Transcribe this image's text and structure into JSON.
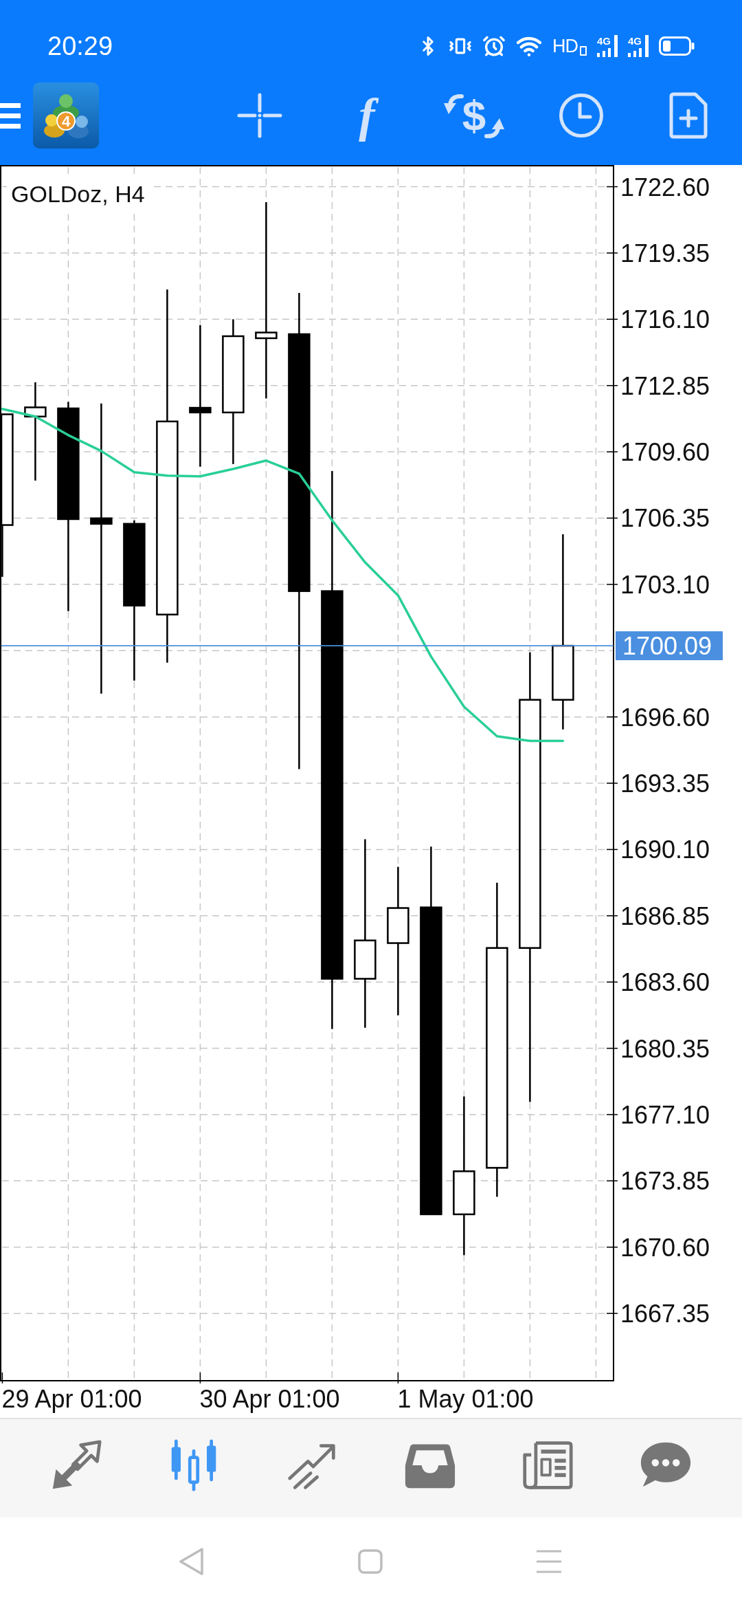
{
  "status_bar": {
    "time": "20:29",
    "hd": "HD",
    "networks": [
      "4G",
      "4G"
    ]
  },
  "toolbar": {
    "logo_badge": "4",
    "actions": [
      {
        "kind": "crosshair"
      },
      {
        "kind": "indicators",
        "glyph": "f"
      },
      {
        "kind": "trade",
        "glyph": "$"
      },
      {
        "kind": "timeframe"
      },
      {
        "kind": "templates"
      }
    ]
  },
  "chart": {
    "title": "GOLDoz, H4",
    "time_labels": [
      "29 Apr 01:00",
      "30 Apr 01:00",
      "1 May 01:00"
    ],
    "chart_data": {
      "type": "line",
      "ylim": [
        1664.05,
        1723.63
      ],
      "yticks": [
        {
          "value": 1722.6,
          "label": "1722.60"
        },
        {
          "value": 1719.35,
          "label": "1719.35"
        },
        {
          "value": 1716.1,
          "label": "1716.10"
        },
        {
          "value": 1712.85,
          "label": "1712.85"
        },
        {
          "value": 1709.6,
          "label": "1709.60"
        },
        {
          "value": 1706.35,
          "label": "1706.35"
        },
        {
          "value": 1703.1,
          "label": "1703.10"
        },
        {
          "value": 1696.6,
          "label": "1696.60"
        },
        {
          "value": 1693.35,
          "label": "1693.35"
        },
        {
          "value": 1690.1,
          "label": "1690.10"
        },
        {
          "value": 1686.85,
          "label": "1686.85"
        },
        {
          "value": 1683.6,
          "label": "1683.60"
        },
        {
          "value": 1680.35,
          "label": "1680.35"
        },
        {
          "value": 1677.1,
          "label": "1677.10"
        },
        {
          "value": 1673.85,
          "label": "1673.85"
        },
        {
          "value": 1670.6,
          "label": "1670.60"
        },
        {
          "value": 1667.35,
          "label": "1667.35"
        }
      ],
      "grid": true,
      "series": [
        {
          "color": "#29cf96",
          "values": [
            1711.7,
            1711.33,
            1710.42,
            1709.64,
            1708.6,
            1708.43,
            1708.4,
            1708.76,
            1709.17,
            1708.53,
            1706.24,
            1704.18,
            1702.56,
            1699.56,
            1697.1,
            1695.65,
            1695.42,
            1695.42
          ]
        }
      ],
      "ref_lines": [
        {
          "axis": "y",
          "value": 1700.09,
          "label": "1700.09",
          "color": "#4a8fe0"
        }
      ]
    }
  },
  "bottom_nav": [
    {
      "kind": "quotes",
      "selected": false
    },
    {
      "kind": "chart",
      "selected": true
    },
    {
      "kind": "trade",
      "selected": false
    },
    {
      "kind": "history",
      "selected": false
    },
    {
      "kind": "news",
      "selected": false
    },
    {
      "kind": "messages",
      "selected": false
    }
  ],
  "system_nav": [
    {
      "kind": "back"
    },
    {
      "kind": "home"
    },
    {
      "kind": "recents"
    }
  ]
}
